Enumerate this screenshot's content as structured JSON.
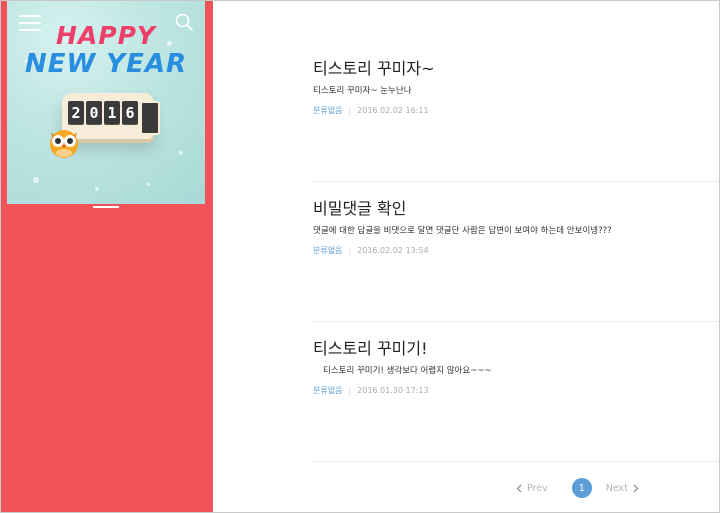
{
  "sidebar": {
    "cover": {
      "line1": "HAPPY",
      "line2": "NEW YEAR",
      "clock_digits": [
        "2",
        "0",
        "1",
        "6"
      ]
    },
    "menu_icon": "hamburger-menu-icon",
    "search_icon": "search-icon",
    "accent_color": "#f2535a"
  },
  "posts": [
    {
      "title": "티스토리 꾸미자~",
      "excerpt": "티스토리 꾸미자~ 눈누난나",
      "category": "분류없음",
      "date": "2016.02.02 16:11"
    },
    {
      "title": "비밀댓글 확인",
      "excerpt": "댓글에 대한 답글을 비댓으로 달면 댓글단 사람은 답변이 보여야 하는데 안보이넹???",
      "category": "분류없음",
      "date": "2016.02.02 13:54"
    },
    {
      "title": "티스토리 꾸미기!",
      "excerpt": "티스토리 꾸미기! 생각보다 어렵지 않아요~~~",
      "category": "분류없음",
      "date": "2016.01.30 17:13"
    }
  ],
  "pagination": {
    "prev_label": "Prev",
    "current_page": "1",
    "next_label": "Next",
    "active_color": "#5b9fd6"
  }
}
